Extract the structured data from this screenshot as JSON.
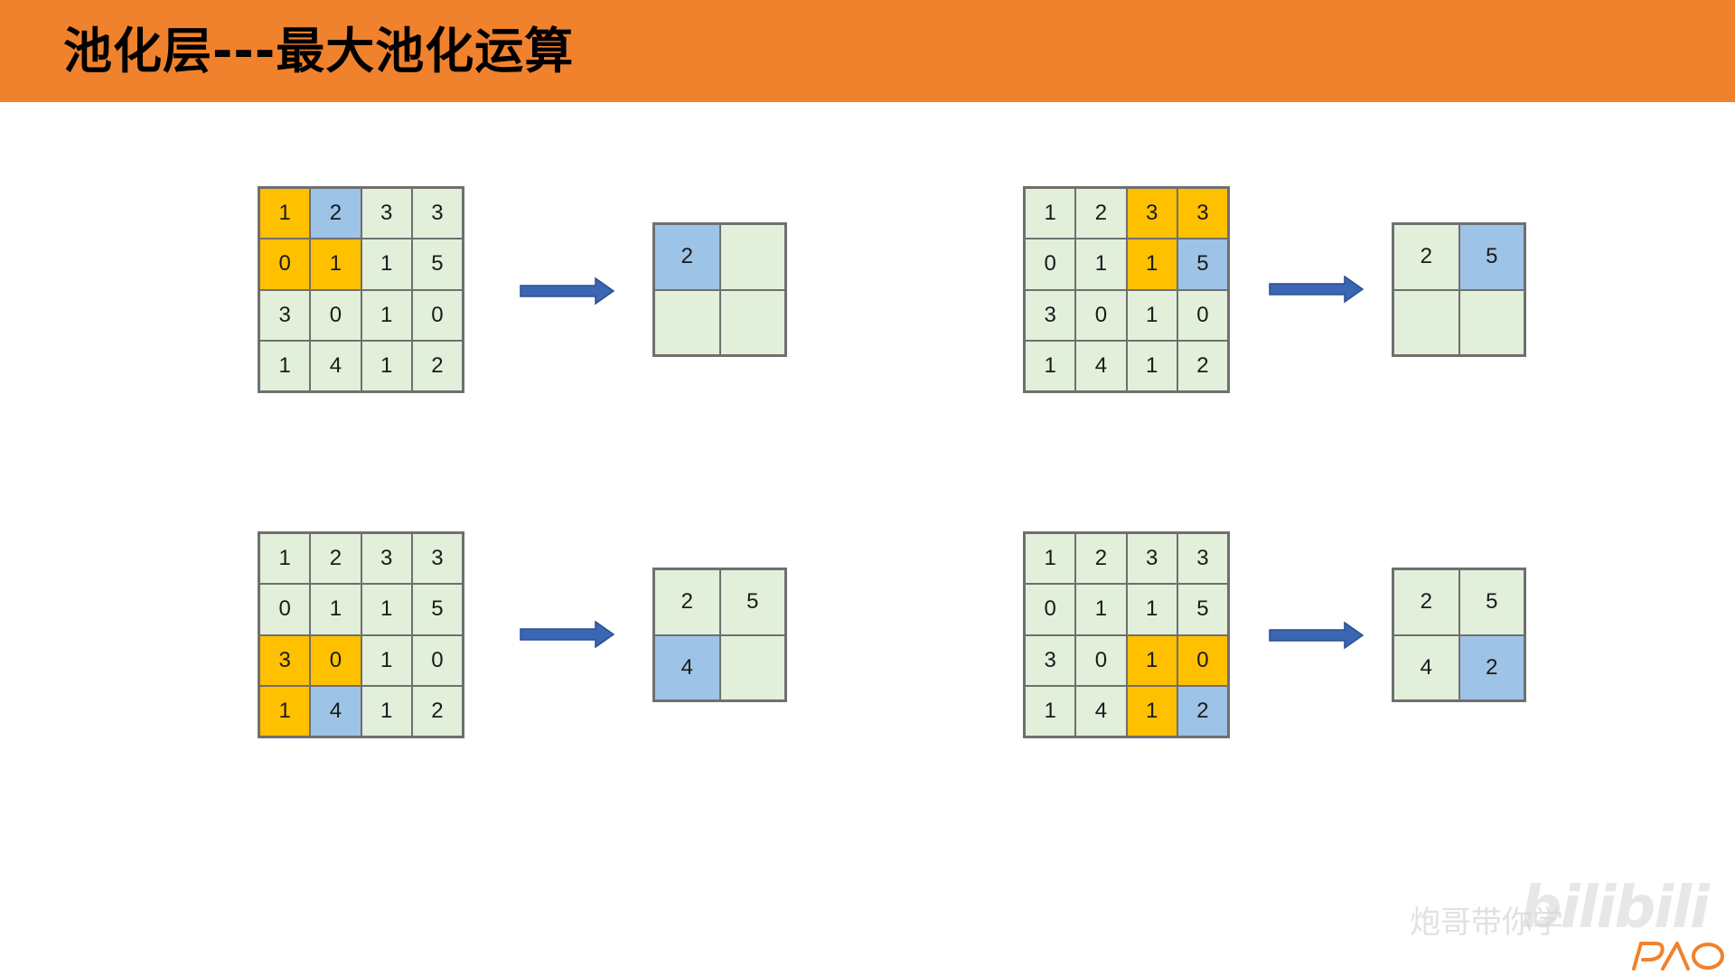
{
  "title": "池化层---最大池化运算",
  "colors": {
    "header": "#f0822d",
    "cell_default": "#e2efda",
    "pool_window": "#ffc000",
    "max_value": "#9dc3e6",
    "arrow": "#3a66b4"
  },
  "input_matrix": [
    [
      "1",
      "2",
      "3",
      "3"
    ],
    [
      "0",
      "1",
      "1",
      "5"
    ],
    [
      "3",
      "0",
      "1",
      "0"
    ],
    [
      "1",
      "4",
      "1",
      "2"
    ]
  ],
  "panels": [
    {
      "step": 1,
      "window_rows": [
        0,
        1
      ],
      "window_cols": [
        0,
        1
      ],
      "max_cell": [
        0,
        1
      ],
      "output": [
        "2",
        "",
        "",
        ""
      ],
      "output_highlight_index": 0
    },
    {
      "step": 2,
      "window_rows": [
        0,
        1
      ],
      "window_cols": [
        2,
        3
      ],
      "max_cell": [
        1,
        3
      ],
      "output": [
        "2",
        "5",
        "",
        ""
      ],
      "output_highlight_index": 1
    },
    {
      "step": 3,
      "window_rows": [
        2,
        3
      ],
      "window_cols": [
        0,
        1
      ],
      "max_cell": [
        3,
        1
      ],
      "output": [
        "2",
        "5",
        "4",
        ""
      ],
      "output_highlight_index": 2
    },
    {
      "step": 4,
      "window_rows": [
        2,
        3
      ],
      "window_cols": [
        2,
        3
      ],
      "max_cell": [
        3,
        3
      ],
      "output": [
        "2",
        "5",
        "4",
        "2"
      ],
      "output_highlight_index": 3
    }
  ],
  "watermark": {
    "text": "炮哥带你学",
    "brand": "bilibili",
    "logo_text": "PAO"
  }
}
